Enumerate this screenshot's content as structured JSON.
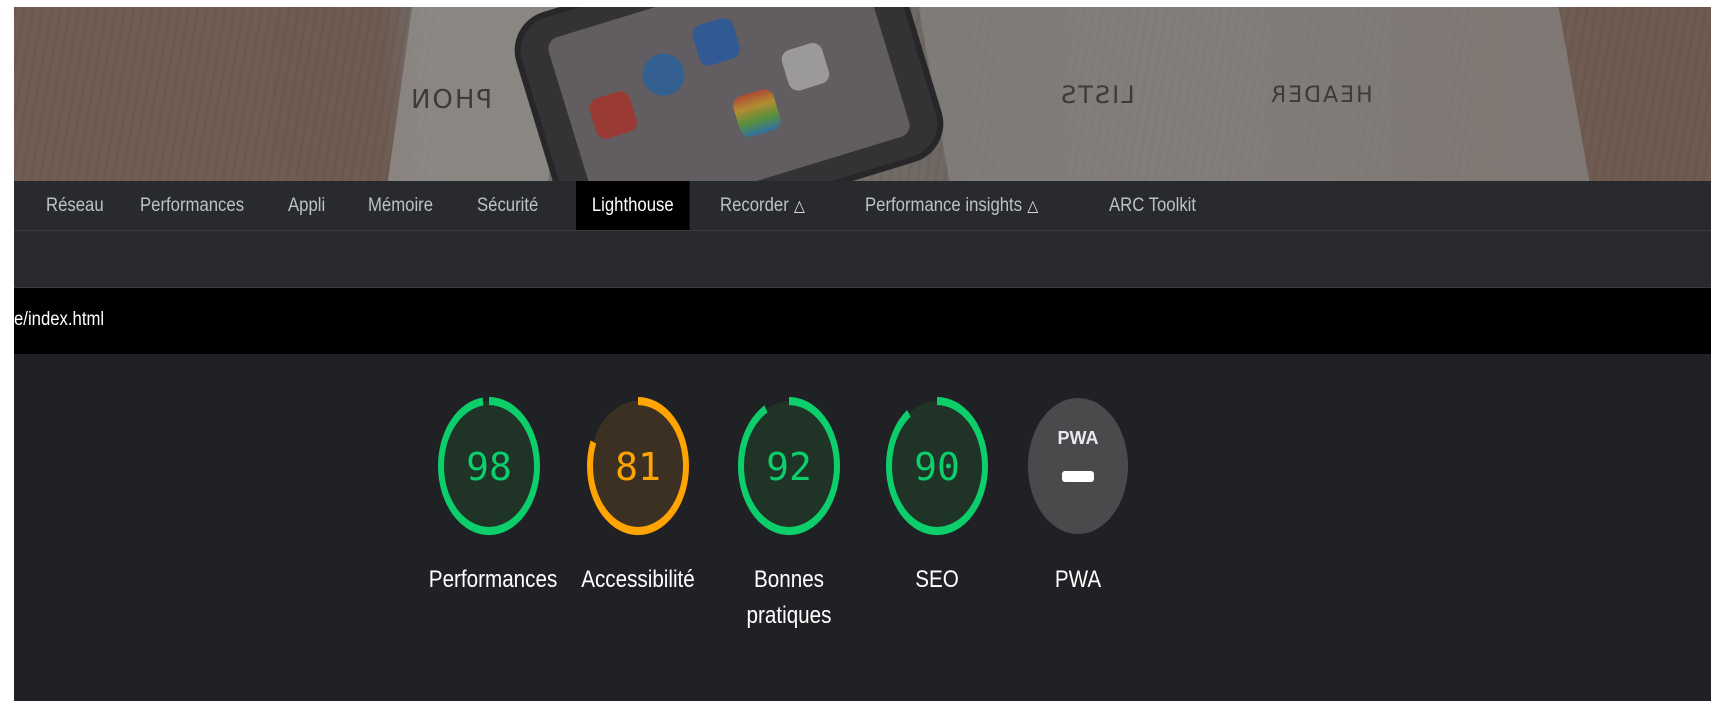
{
  "tabs": {
    "items": [
      {
        "label": "Réseau"
      },
      {
        "label": "Performances"
      },
      {
        "label": "Appli"
      },
      {
        "label": "Mémoire"
      },
      {
        "label": "Sécurité"
      },
      {
        "label": "Lighthouse"
      },
      {
        "label": "Recorder",
        "icon": "flask-icon"
      },
      {
        "label": "Performance insights",
        "icon": "flask-icon"
      },
      {
        "label": "ARC Toolkit"
      }
    ],
    "active": "Lighthouse"
  },
  "url": {
    "text": "e/index.html"
  },
  "scores": [
    {
      "value": "98",
      "label": "Performances",
      "color": "#0cce6b",
      "fraction": 0.98
    },
    {
      "value": "81",
      "label": "Accessibilité",
      "color": "#ffa400",
      "fraction": 0.81
    },
    {
      "value": "92",
      "label": "Bonnes",
      "label2": "pratiques",
      "color": "#0cce6b",
      "fraction": 0.92
    },
    {
      "value": "90",
      "label": "SEO",
      "color": "#0cce6b",
      "fraction": 0.9
    }
  ],
  "pwa": {
    "badge": "PWA",
    "label": "PWA",
    "status": "not-applicable"
  },
  "hero": {
    "scribble_left": "PHON",
    "scribble_mid": "LISTS",
    "scribble_right": "HEADER"
  },
  "colors": {
    "pass": "#0cce6b",
    "average": "#ffa400",
    "panel_bg": "#202124",
    "tabbar_bg": "#292a2d"
  }
}
